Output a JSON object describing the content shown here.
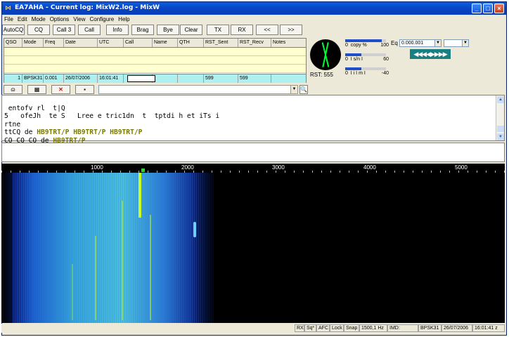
{
  "window": {
    "title": "EA7AHA - Current log: MixW2.log - MixW",
    "controls": {
      "minimize": "_",
      "maximize": "□",
      "close": "×"
    }
  },
  "menu": [
    "File",
    "Edit",
    "Mode",
    "Options",
    "View",
    "Configure",
    "Help"
  ],
  "toolbar": {
    "buttons": [
      "AutoCQ",
      "CQ",
      "Call 3",
      "Call",
      "Info",
      "Brag",
      "Bye",
      "Clear",
      "TX",
      "RX",
      "<<",
      ">>"
    ]
  },
  "log": {
    "columns": [
      "QSO",
      "Mode",
      "Freq",
      "Date",
      "UTC",
      "Call",
      "Name",
      "QTH",
      "RST_Sent",
      "RST_Recv",
      "Notes"
    ],
    "current_row": {
      "qso": "1",
      "mode": "BPSK31",
      "freq": "0.001",
      "date": "26/07/2006",
      "utc": "16:01:41",
      "call": "",
      "name": "",
      "qth": "",
      "rst_sent": "599",
      "rst_recv": "599",
      "notes": ""
    }
  },
  "meters": {
    "rst_label": "RST: 555",
    "copy": {
      "left": "0",
      "mid": "copy %",
      "right": "100",
      "fraction": 0.9
    },
    "sn": {
      "left": "0",
      "mid": "I s/n I",
      "right": "60",
      "fraction": 0.4
    },
    "imd": {
      "left": "0",
      "mid": "I i I m I",
      "right": "-40",
      "fraction": 0.4
    }
  },
  "eq": {
    "label": "Eq",
    "frequency": "0.000.001",
    "tuner_arrows": "◀◀◀◀▶▶▶▶"
  },
  "macro_row": {
    "icons": [
      "sound-icon",
      "picture-icon",
      "delete-icon",
      "save-icon"
    ],
    "icon_glyphs": [
      "ɷ",
      "▦",
      "✕",
      "▪"
    ],
    "find_glyph": "🔍"
  },
  "rx_text": {
    "line1": " entofv rl  t|Q",
    "line2": "5   ofeJh  te S   Lree e tric1dn  t  tptdi h et iTs i",
    "line3": "rtne",
    "line4_prefix": "ttCQ de ",
    "line4_calls": "HB9TRT/P HB9TRT/P HB9TRT/P",
    "line5_prefix": "CQ CQ CQ de ",
    "line5_calls": "HB9TRT/P"
  },
  "spectrum": {
    "ticks": [
      "1000",
      "2000",
      "3000",
      "4000",
      "5000"
    ]
  },
  "status": {
    "rx": "RX",
    "sq": "Sq*",
    "afc": "AFC",
    "lock": "Lock",
    "snap": "Snap",
    "freq": "1500,1 Hz",
    "imd": "IMD:",
    "mode": "BPSK31",
    "date": "26/07/2006",
    "time": "16:01:41 z"
  },
  "colors": {
    "titlebar": "#0a4ad0",
    "signal": "#c6ff2a",
    "callsign": "#7a7a00",
    "qso_row": "#aef0f0"
  }
}
